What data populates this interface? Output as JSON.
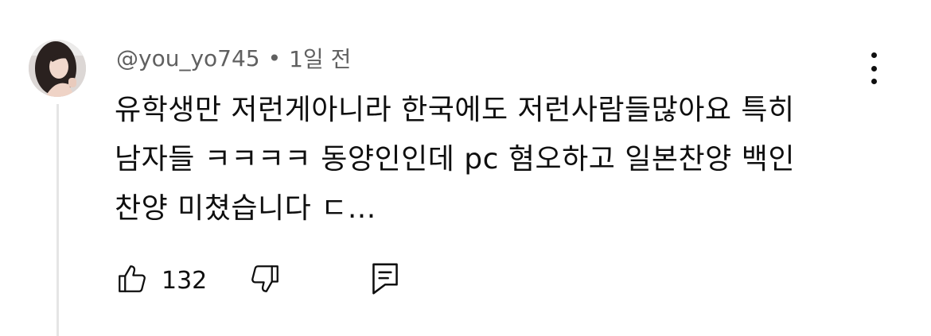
{
  "comment": {
    "author": "@you_yo745",
    "separator": "•",
    "time": "1일 전",
    "lines": [
      "유학생만 저런게아니라 한국에도 저런사람들많아요 특히",
      "남자들 ㅋㅋㅋㅋ 동양인인데 pc 혐오하고 일본찬양 백인",
      "찬양 미쳤습니다 ㄷ..."
    ],
    "like_count": "132"
  },
  "icons": {
    "like": "thumbs-up-icon",
    "dislike": "thumbs-down-icon",
    "reply": "reply-comment-icon",
    "menu": "more-vertical-icon"
  },
  "colors": {
    "text": "#0f0f0f",
    "secondary_text": "#606060",
    "thread_line": "#e5e5e5",
    "background": "#ffffff"
  }
}
